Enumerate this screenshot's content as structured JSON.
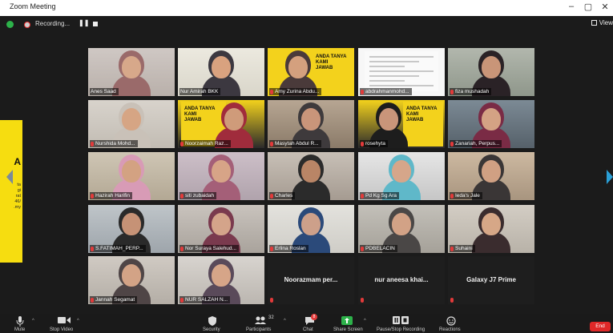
{
  "window": {
    "title": "Zoom Meeting",
    "controls": [
      "–",
      "▢",
      "✕"
    ]
  },
  "recording": {
    "label": "Recording...",
    "pause_glyph": "❚❚"
  },
  "view": {
    "label": "View"
  },
  "side_note": {
    "big": "A",
    "lines": [
      "ta",
      "gi",
      "rat",
      "46/",
      ".my"
    ]
  },
  "participants": [
    {
      "name": "Anes Saad"
    },
    {
      "name": "Nur Amirah BKK"
    },
    {
      "name": "Amy Zurina Abdu..."
    },
    {
      "name": "abdrahmanmohd..."
    },
    {
      "name": "fiza mushadah"
    },
    {
      "name": "Nurshida Mohd..."
    },
    {
      "name": "Noorzaimah Raz..."
    },
    {
      "name": "Masytah Abdul R..."
    },
    {
      "name": "rosehyta"
    },
    {
      "name": "Zanariah, Perpus..."
    },
    {
      "name": "Hazirah Harifin"
    },
    {
      "name": "siti zubaidah"
    },
    {
      "name": "Charles"
    },
    {
      "name": "Pd Kg Sg Ara"
    },
    {
      "name": "Ieda's Jale"
    },
    {
      "name": "S.FATIMAH_PERP..."
    },
    {
      "name": "Nor Suraya Salehud..."
    },
    {
      "name": "Erlina Roslan"
    },
    {
      "name": "PDBELACIN"
    },
    {
      "name": "Suhaini"
    },
    {
      "name": "Jannah Segamat"
    },
    {
      "name": "NUR SALZAH N..."
    },
    {
      "name": "Noorazmam per..."
    },
    {
      "name": "nur aneesa khai..."
    },
    {
      "name": "Galaxy J7 Prime"
    }
  ],
  "poster_text": "ANDA TANYA\nKAMI\nJAWAB",
  "toolbar": {
    "mute": "Mute",
    "stop_video": "Stop Video",
    "security": "Security",
    "participants": "Participants",
    "participants_count": "32",
    "chat": "Chat",
    "chat_badge": "8",
    "share_screen": "Share Screen",
    "pause_recording": "Pause/Stop Recording",
    "reactions": "Reactions",
    "end": "End"
  },
  "colors": {
    "active_speaker": "#e2e82a",
    "share_green": "#2db24a",
    "end_red": "#e02828"
  }
}
